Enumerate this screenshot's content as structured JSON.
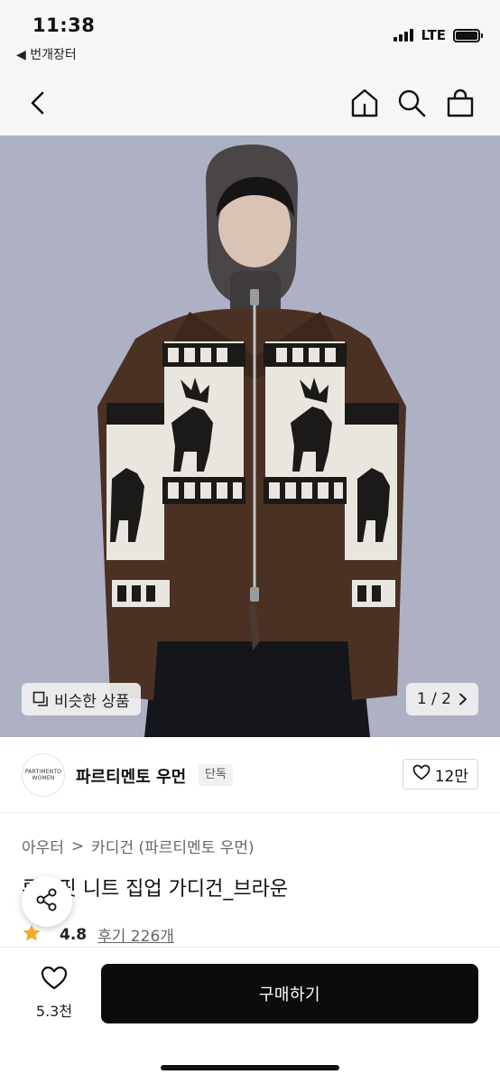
{
  "status_bar": {
    "time": "11:38",
    "back_app_label": "◀ 번개장터",
    "network": "LTE",
    "icons": [
      "signal-bars-icon",
      "battery-icon"
    ]
  },
  "nav": {
    "icons": [
      "back-chevron-icon",
      "home-icon",
      "search-icon",
      "shopping-bag-icon"
    ]
  },
  "gallery": {
    "similar_label": "비슷한 상품",
    "similar_icon": "similar-items-icon",
    "counter": "1 / 2",
    "next_icon": "chevron-right-icon",
    "colors": {
      "background": "#aeb1c4",
      "sweater_brown": "#4b3124",
      "sweater_cream": "#e8e6df",
      "pattern_black": "#1b1a18"
    }
  },
  "brand": {
    "logo_line1": "PARTIMENTO",
    "logo_line2": "WOMEN",
    "name": "파르티멘토 우먼",
    "badge": "단독",
    "like_icon": "heart-outline-icon",
    "like_count": "12만"
  },
  "product": {
    "breadcrumb": [
      "아우터",
      "카디건 (파르티멘토 우먼)"
    ],
    "breadcrumb_separator": ">",
    "title": "루즈핏 니트 집업 가디건_브라운",
    "rating": "4.8",
    "review_label": "후기 226개",
    "rating_icon": "star-icon",
    "share_icon": "share-icon"
  },
  "bottom_bar": {
    "wish_icon": "heart-outline-icon",
    "wish_count": "5.3천",
    "buy_label": "구매하기",
    "buy_color": "#0c0c0c"
  }
}
